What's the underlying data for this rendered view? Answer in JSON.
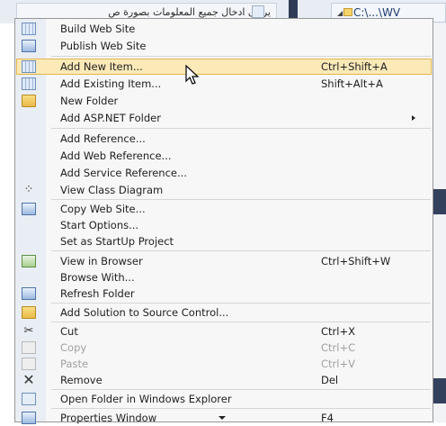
{
  "background": {
    "arabic_text": "يرجى ادخال جميع المعلومات  بصورة ص",
    "path_text": "C:\\...\\WV"
  },
  "menu": {
    "items": [
      {
        "label": "Build Web Site",
        "shortcut": "",
        "icon": "build-icon"
      },
      {
        "label": "Publish Web Site",
        "shortcut": "",
        "icon": "publish-icon"
      },
      {
        "label": "Add New Item...",
        "shortcut": "Ctrl+Shift+A",
        "icon": "add-new-item-icon",
        "highlighted": true
      },
      {
        "label": "Add Existing Item...",
        "shortcut": "Shift+Alt+A",
        "icon": "add-existing-item-icon"
      },
      {
        "label": "New Folder",
        "shortcut": "",
        "icon": "new-folder-icon"
      },
      {
        "label": "Add ASP.NET Folder",
        "shortcut": "",
        "submenu": true
      },
      {
        "label": "Add Reference...",
        "shortcut": ""
      },
      {
        "label": "Add Web Reference...",
        "shortcut": ""
      },
      {
        "label": "Add Service Reference...",
        "shortcut": ""
      },
      {
        "label": "View Class Diagram",
        "shortcut": "",
        "icon": "class-diagram-icon"
      },
      {
        "label": "Copy Web Site...",
        "shortcut": "",
        "icon": "copy-web-site-icon"
      },
      {
        "label": "Start Options...",
        "shortcut": ""
      },
      {
        "label": "Set as StartUp Project",
        "shortcut": ""
      },
      {
        "label": "View in Browser",
        "shortcut": "Ctrl+Shift+W",
        "icon": "view-in-browser-icon"
      },
      {
        "label": "Browse With...",
        "shortcut": ""
      },
      {
        "label": "Refresh Folder",
        "shortcut": "",
        "icon": "refresh-icon"
      },
      {
        "label": "Add Solution to Source Control...",
        "shortcut": "",
        "icon": "source-control-icon"
      },
      {
        "label": "Cut",
        "shortcut": "Ctrl+X",
        "icon": "cut-icon"
      },
      {
        "label": "Copy",
        "shortcut": "Ctrl+C",
        "icon": "copy-icon",
        "disabled": true
      },
      {
        "label": "Paste",
        "shortcut": "Ctrl+V",
        "icon": "paste-icon",
        "disabled": true
      },
      {
        "label": "Remove",
        "shortcut": "Del",
        "icon": "remove-icon"
      },
      {
        "label": "Open Folder in Windows Explorer",
        "shortcut": "",
        "icon": "open-folder-icon"
      },
      {
        "label": "Properties Window",
        "shortcut": "F4",
        "icon": "properties-icon"
      }
    ]
  }
}
